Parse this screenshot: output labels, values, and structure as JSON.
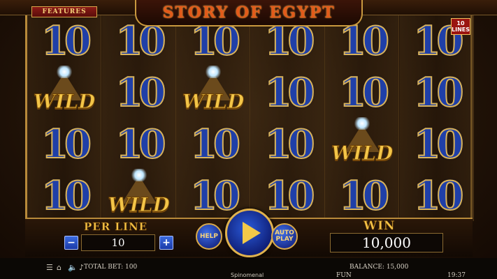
{
  "header": {
    "features_label": "FEATURES",
    "game_title": "STORY OF EGYPT",
    "lines_badge_top": "10",
    "lines_badge_bottom": "LINES"
  },
  "reels": [
    [
      "10",
      "WILD",
      "10",
      "10"
    ],
    [
      "10",
      "10",
      "10",
      "WILD"
    ],
    [
      "10",
      "WILD",
      "10",
      "10"
    ],
    [
      "10",
      "10",
      "10",
      "10"
    ],
    [
      "10",
      "10",
      "WILD",
      "10"
    ],
    [
      "10",
      "10",
      "10",
      "10"
    ]
  ],
  "controls": {
    "per_line_label": "PER LINE",
    "per_line_value": "10",
    "minus_label": "−",
    "plus_label": "+",
    "help_label": "HELP",
    "autoplay_label_1": "AUTO",
    "autoplay_label_2": "PLAY",
    "win_label": "WIN",
    "win_value": "10,000"
  },
  "status": {
    "total_bet": "TOTAL BET: 100",
    "balance": "BALANCE: 15,000",
    "mode": "FUN",
    "time": "19:37",
    "brand": "Spinomenal"
  },
  "icons": {
    "menu": "menu-icon",
    "home": "home-icon",
    "sound": "sound-icon",
    "music": "music-icon"
  },
  "colors": {
    "gold": "#f2c146",
    "blue": "#1f3fa8",
    "title_orange": "#e25a1a"
  }
}
